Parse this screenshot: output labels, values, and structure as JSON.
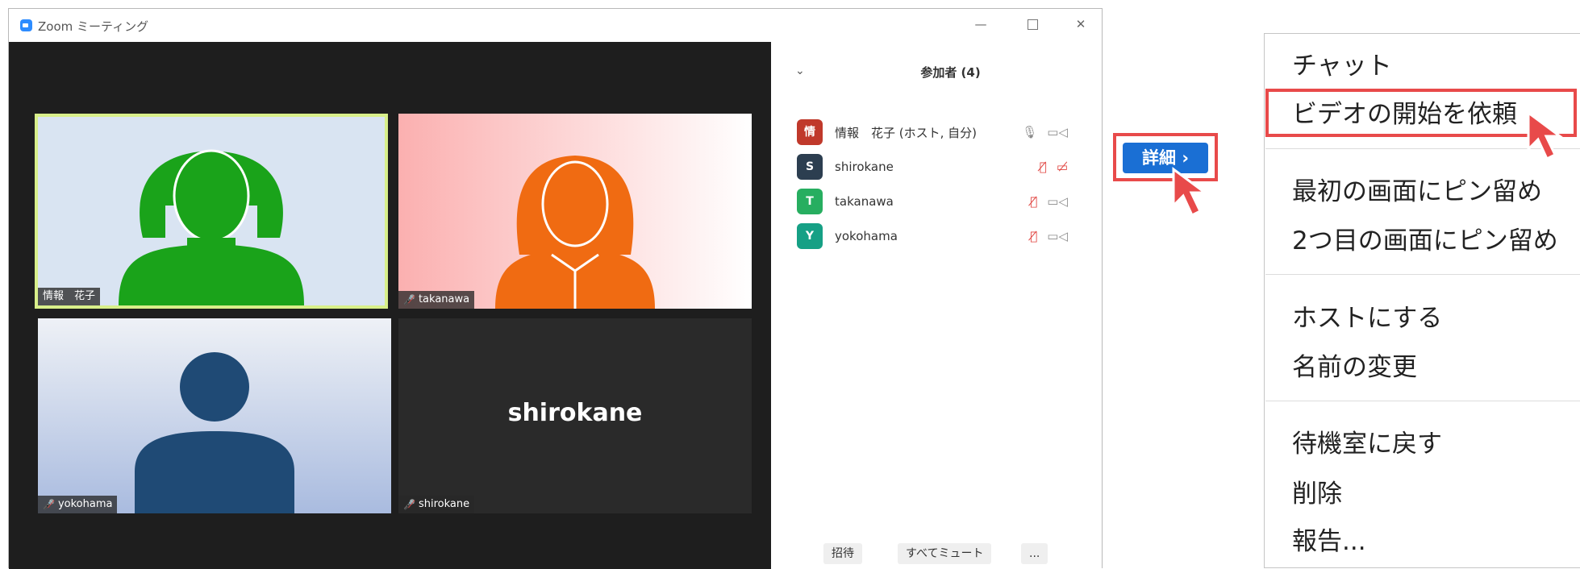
{
  "window": {
    "title": "Zoom ミーティング",
    "controls": {
      "minimize": "—",
      "close": "✕"
    }
  },
  "video": {
    "tiles": [
      {
        "name": "情報　花子",
        "muted": false,
        "color": "#1aa31a"
      },
      {
        "name": "takanawa",
        "muted": true,
        "color": "#f06b12"
      },
      {
        "name": "yokohama",
        "muted": true,
        "color": "#1f4a75"
      },
      {
        "name": "shirokane",
        "muted": true,
        "big_name": "shirokane"
      }
    ]
  },
  "participants_panel": {
    "collapse_icon": "chevron-down-icon",
    "title": "参加者 (4)",
    "participants": [
      {
        "initial": "情",
        "name": "情報　花子 (ホスト, 自分)",
        "avatar_color": "#c0392b",
        "mic_muted": false,
        "video_off": false
      },
      {
        "initial": "S",
        "name": "shirokane",
        "avatar_color": "#2c3e50",
        "mic_muted": true,
        "video_off": true
      },
      {
        "initial": "T",
        "name": "takanawa",
        "avatar_color": "#27ae60",
        "mic_muted": true,
        "video_off": false
      },
      {
        "initial": "Y",
        "name": "yokohama",
        "avatar_color": "#16a085",
        "mic_muted": true,
        "video_off": false
      }
    ],
    "buttons": {
      "invite": "招待",
      "mute_all": "すべてミュート",
      "more": "..."
    }
  },
  "detail_button": {
    "label": "詳細 ›"
  },
  "context_menu": {
    "items": [
      "チャット",
      "ビデオの開始を依頼",
      "最初の画面にピン留め",
      "2つ目の画面にピン留め",
      "ホストにする",
      "名前の変更",
      "待機室に戻す",
      "削除",
      "報告..."
    ],
    "highlighted": "ビデオの開始を依頼"
  },
  "colors": {
    "accent": "#e84a4a",
    "zoom_blue": "#2d8cff",
    "detail_blue": "#1a6fd4"
  }
}
